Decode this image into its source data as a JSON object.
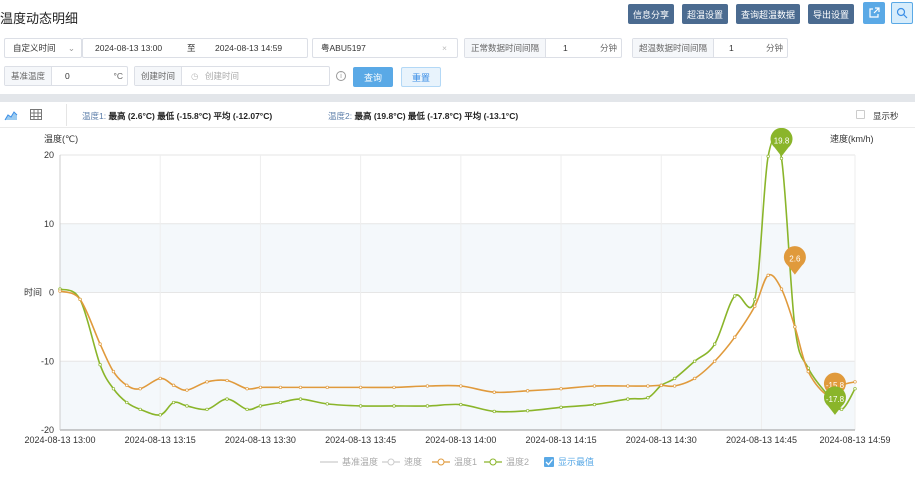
{
  "header": {
    "title": "温度动态明细",
    "buttons": [
      "信息分享",
      "超温设置",
      "查询超温数据",
      "导出设置"
    ]
  },
  "filters": {
    "time_mode": "自定义时间",
    "start_time": "2024-08-13 13:00",
    "to_label": "至",
    "end_time": "2024-08-13 14:59",
    "plate": "粤ABU5197",
    "normal_interval_label": "正常数据时间间隔",
    "normal_interval_value": "1",
    "interval_unit": "分钟",
    "over_interval_label": "超温数据时间间隔",
    "over_interval_value": "1",
    "base_temp_label": "基准温度",
    "base_temp_value": "0",
    "base_temp_unit": "°C",
    "create_time_label": "创建时间",
    "create_time_placeholder": "创建时间",
    "query_label": "查询",
    "reset_label": "重置"
  },
  "toolbar": {
    "t1_label": "温度1:",
    "t1_stats": "最高 (2.6°C)  最低 (-15.8°C)  平均 (-12.07°C)",
    "t2_label": "温度2:",
    "t2_stats": "最高 (19.8°C)  最低 (-17.8°C)  平均 (-13.1°C)",
    "show_seconds": "显示秒"
  },
  "colors": {
    "temp1": "#e09a3c",
    "temp2": "#8ab52a",
    "accent": "#5aa9e6",
    "header_btn": "#4b6b90"
  },
  "chart_data": {
    "type": "line",
    "ylabel_left": "温度(℃)",
    "ylabel_right": "速度(km/h)",
    "y_side_label": "时间",
    "ylim": [
      -20,
      20
    ],
    "y_ticks": [
      "20",
      "10",
      "0",
      "-10",
      "-20"
    ],
    "x_ticks": [
      "2024-08-13 13:00",
      "2024-08-13 13:15",
      "2024-08-13 13:30",
      "2024-08-13 13:45",
      "2024-08-13 14:00",
      "2024-08-13 14:15",
      "2024-08-13 14:30",
      "2024-08-13 14:45",
      "2024-08-13 14:59"
    ],
    "x_minutes": [
      0,
      3,
      6,
      8,
      10,
      12,
      15,
      17,
      19,
      22,
      25,
      28,
      30,
      33,
      36,
      40,
      45,
      50,
      55,
      60,
      65,
      70,
      75,
      80,
      85,
      88,
      90,
      92,
      95,
      98,
      101,
      104,
      106,
      108,
      110,
      112,
      115,
      117,
      119
    ],
    "series": [
      {
        "name": "温度1",
        "values": [
          0.2,
          -1.0,
          -7.5,
          -11.5,
          -13.5,
          -14.0,
          -12.5,
          -13.5,
          -14.2,
          -13.0,
          -12.8,
          -14.0,
          -13.8,
          -13.8,
          -13.8,
          -13.8,
          -13.8,
          -13.8,
          -13.6,
          -13.6,
          -14.5,
          -14.3,
          -14.0,
          -13.6,
          -13.6,
          -13.6,
          -13.5,
          -13.6,
          -12.5,
          -10.0,
          -6.5,
          -2.0,
          2.5,
          0.5,
          -5.0,
          -11.5,
          -15.0,
          -13.5,
          -13.0
        ]
      },
      {
        "name": "温度2",
        "values": [
          0.5,
          -1.0,
          -10.5,
          -14.0,
          -16.0,
          -17.0,
          -17.8,
          -16.0,
          -16.5,
          -17.0,
          -15.5,
          -17.0,
          -16.5,
          -16.0,
          -15.5,
          -16.2,
          -16.5,
          -16.5,
          -16.5,
          -16.3,
          -17.3,
          -17.2,
          -16.7,
          -16.3,
          -15.5,
          -15.3,
          -13.5,
          -12.5,
          -10.0,
          -7.5,
          -0.5,
          -1.0,
          19.8,
          19.5,
          -5.0,
          -11.0,
          -15.0,
          -17.0,
          -14.0
        ]
      }
    ],
    "markers": [
      {
        "series": "温度2",
        "label": "19.8",
        "x": 108,
        "y": 19.8
      },
      {
        "series": "温度1",
        "label": "2.6",
        "x": 110,
        "y": 2.6
      },
      {
        "series": "温度1",
        "label": "-15.8",
        "x": 116,
        "y": -15.8
      },
      {
        "series": "温度2",
        "label": "-17.8",
        "x": 116,
        "y": -17.8
      }
    ],
    "legend": [
      "基准温度",
      "速度",
      "温度1",
      "温度2",
      "显示最值"
    ]
  }
}
